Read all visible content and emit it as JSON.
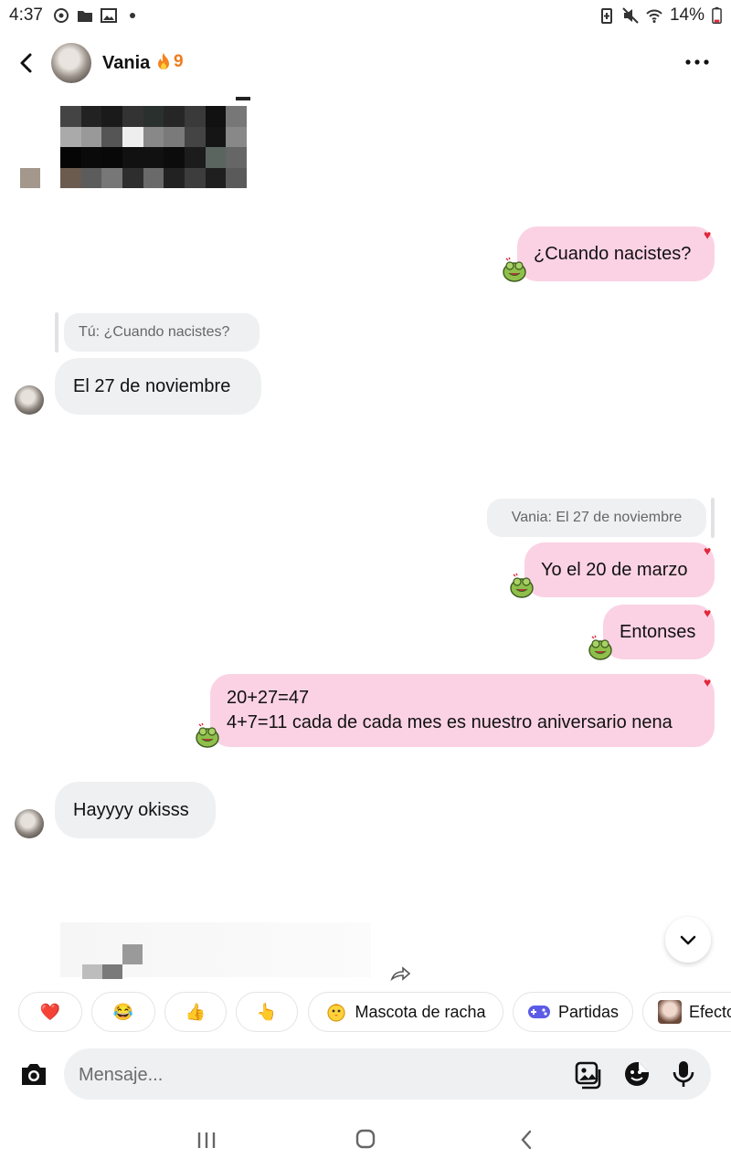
{
  "status_bar": {
    "time": "4:37",
    "battery": "14%"
  },
  "header": {
    "contact_name": "Vania",
    "streak_count": "9"
  },
  "messages": {
    "out_1": "¿Cuando nacistes?",
    "reply_quote_1": "Tú: ¿Cuando nacistes?",
    "in_1": "El 27 de noviembre",
    "reply_quote_2": "Vania: El 27 de noviembre",
    "out_2": "Yo el 20 de marzo",
    "out_3": "Entonses",
    "out_4_line1": "20+27=47",
    "out_4_line2": "4+7=11 cada de cada mes es nuestro aniversario nena",
    "in_2": "Hayyyy okisss"
  },
  "quick_actions": {
    "heart": "❤️",
    "laugh": "😂",
    "thumbs": "👍",
    "point": "👆",
    "pet_label": "Mascota de racha",
    "games_label": "Partidas",
    "effects_label": "Efecto"
  },
  "composer": {
    "placeholder": "Mensaje..."
  },
  "colors": {
    "outgoing_bubble": "#fbd2e4",
    "incoming_bubble": "#eff0f2",
    "heart": "#e0283a",
    "streak": "#f07a1a"
  }
}
